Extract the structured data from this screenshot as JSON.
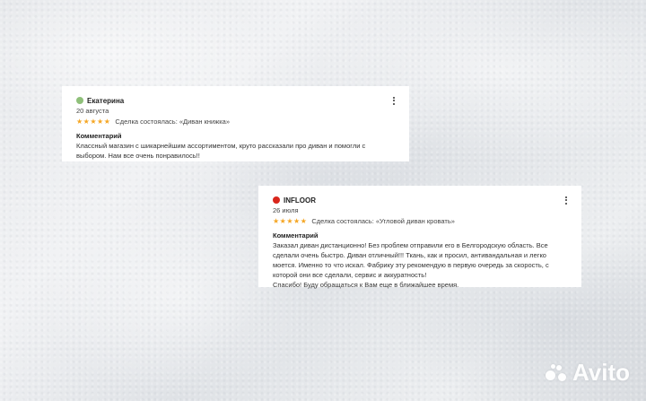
{
  "reviews": [
    {
      "author": "Екатерина",
      "date": "20 августа",
      "rating": 5,
      "stars": "★★★★★",
      "deal": "Сделка состоялась: «Диван книжка»",
      "comment_label": "Комментарий",
      "comment_lines": [
        "Классный магазин с шикарнейшим ассортиментом, круто рассказали про диван и помогли с",
        "выбором. Нам все очень понравилось!!"
      ]
    },
    {
      "author": "INFLOOR",
      "date": "26 июля",
      "rating": 5,
      "stars": "★★★★★",
      "deal": "Сделка состоялась: «Угловой диван кровать»",
      "comment_label": "Комментарий",
      "comment_lines": [
        "Заказал диван дистанционно! Без проблем отправили его в Белгородскую область. Все",
        "сделали очень быстро. Диван отличный!!! Ткань, как и просил, антивандальная и легко",
        "моется. Именно то что искал. Фабрику эту рекомендую в первую очередь за скорость, с",
        "которой они все сделали, сервис и аккуратность!",
        "Спасибо! Буду обращаться к Вам еще в ближайшее время."
      ]
    }
  ],
  "watermark": {
    "text": "Avito"
  },
  "colors": {
    "star": "#f5a623",
    "avatar_1": "#8fc07a",
    "avatar_2": "#d9261c"
  }
}
